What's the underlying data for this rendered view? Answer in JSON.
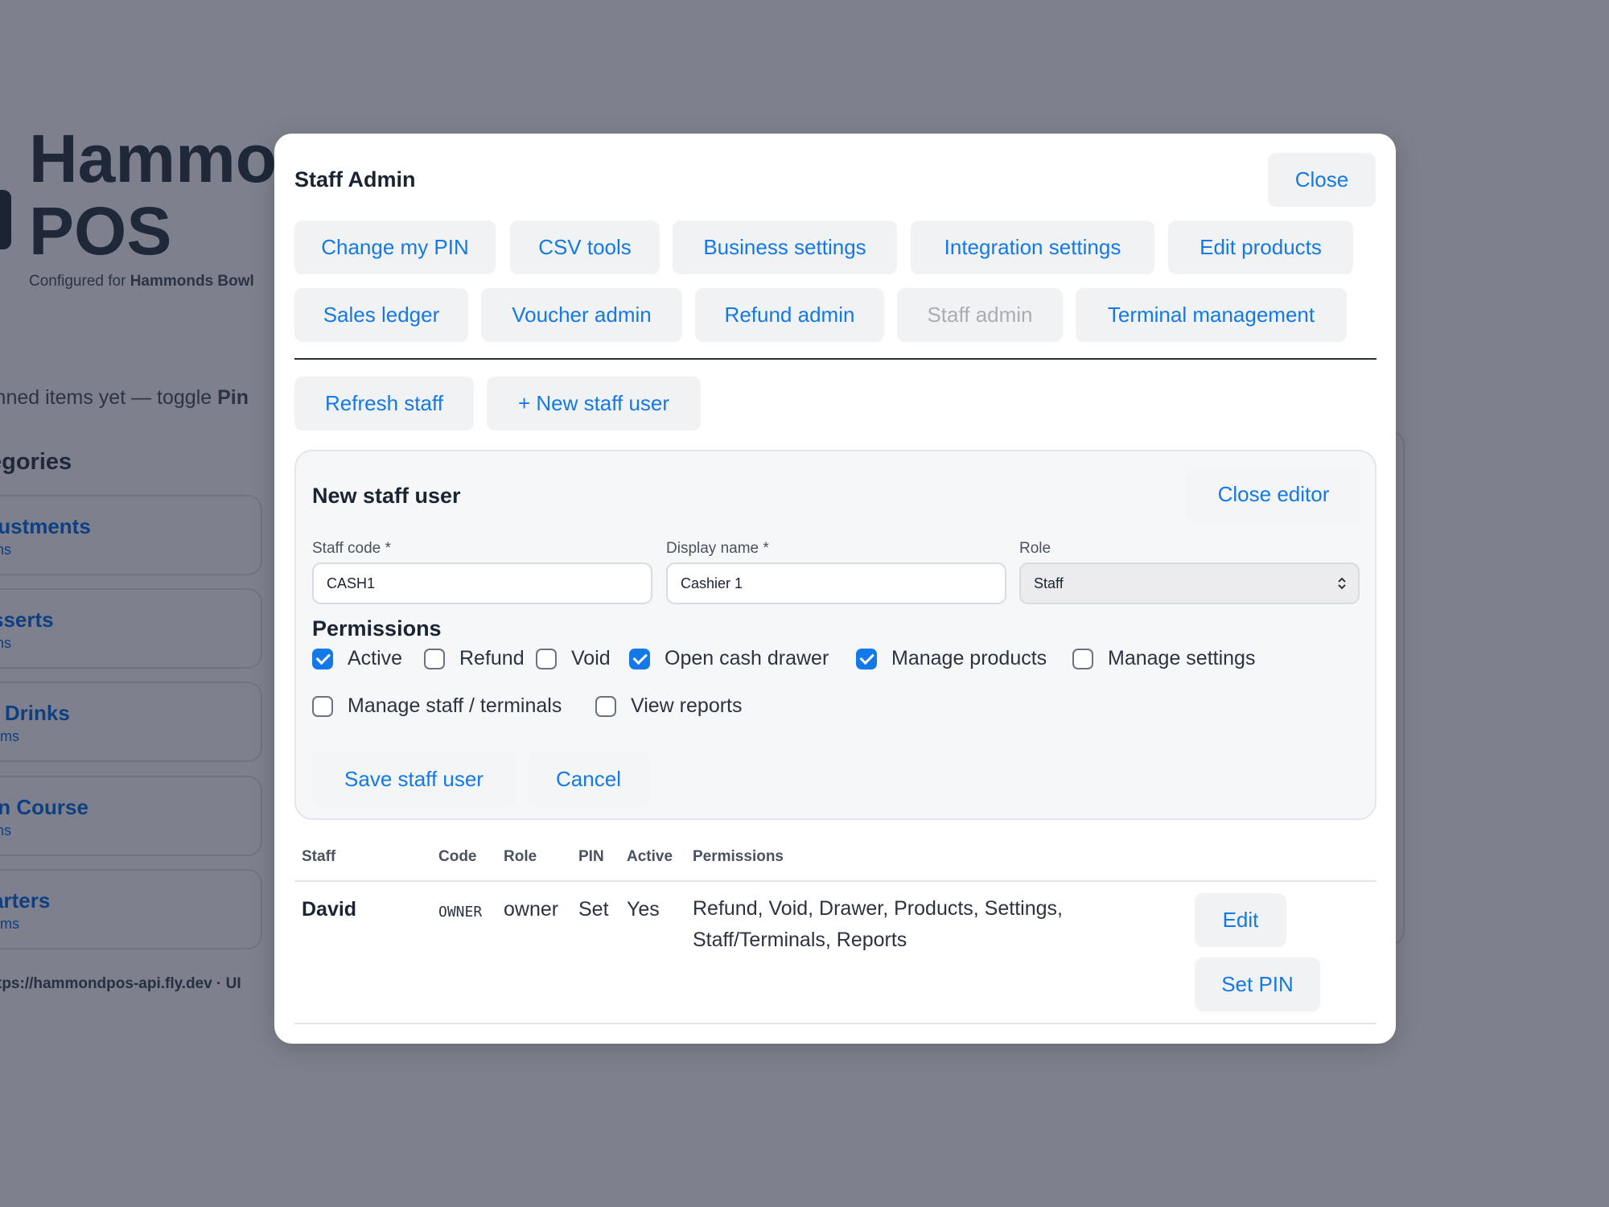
{
  "background": {
    "app_title": "Hammo\nPOS",
    "configured_prefix": "Configured for",
    "configured_business": "Hammonds Bowl",
    "pinned_text": "inned items yet — toggle",
    "pinned_bold": "Pin",
    "categories_heading": "egories",
    "categories": [
      {
        "name": "justments",
        "sub": "ms"
      },
      {
        "name": "sserts",
        "sub": "ms"
      },
      {
        "name": "t Drinks",
        "sub": "ems"
      },
      {
        "name": "in Course",
        "sub": "ms"
      },
      {
        "name": "arters",
        "sub": "ems"
      }
    ],
    "footer": "tps://hammondpos-api.fly.dev · UI"
  },
  "modal": {
    "title": "Staff Admin",
    "close_label": "Close",
    "tabs": [
      {
        "label": "Change my PIN",
        "disabled": false
      },
      {
        "label": "CSV tools",
        "disabled": false
      },
      {
        "label": "Business settings",
        "disabled": false
      },
      {
        "label": "Integration settings",
        "disabled": false
      },
      {
        "label": "Edit products",
        "disabled": false
      },
      {
        "label": "Sales ledger",
        "disabled": false
      },
      {
        "label": "Voucher admin",
        "disabled": false
      },
      {
        "label": "Refund admin",
        "disabled": false
      },
      {
        "label": "Staff admin",
        "disabled": true
      },
      {
        "label": "Terminal management",
        "disabled": false
      }
    ],
    "refresh_label": "Refresh staff",
    "new_user_label": "+ New staff user"
  },
  "editor": {
    "title": "New staff user",
    "close_editor_label": "Close editor",
    "staff_code_label": "Staff code *",
    "staff_code_value": "CASH1",
    "display_name_label": "Display name *",
    "display_name_value": "Cashier 1",
    "role_label": "Role",
    "role_value": "Staff",
    "permissions_title": "Permissions",
    "permissions": [
      {
        "label": "Active",
        "checked": true
      },
      {
        "label": "Refund",
        "checked": false
      },
      {
        "label": "Void",
        "checked": false
      },
      {
        "label": "Open cash drawer",
        "checked": true
      },
      {
        "label": "Manage products",
        "checked": true
      },
      {
        "label": "Manage settings",
        "checked": false
      },
      {
        "label": "Manage staff / terminals",
        "checked": false
      },
      {
        "label": "View reports",
        "checked": false
      }
    ],
    "save_label": "Save staff user",
    "cancel_label": "Cancel"
  },
  "table": {
    "headers": [
      "Staff",
      "Code",
      "Role",
      "PIN",
      "Active",
      "Permissions"
    ],
    "rows": [
      {
        "staff": "David",
        "code": "OWNER",
        "role": "owner",
        "pin": "Set",
        "active": "Yes",
        "permissions": "Refund, Void, Drawer, Products, Settings, Staff/Terminals, Reports",
        "edit_label": "Edit",
        "set_pin_label": "Set PIN"
      }
    ]
  },
  "colors": {
    "accent": "#1479e8",
    "overlay": "#7e818d",
    "disabled": "#a9adb4"
  }
}
